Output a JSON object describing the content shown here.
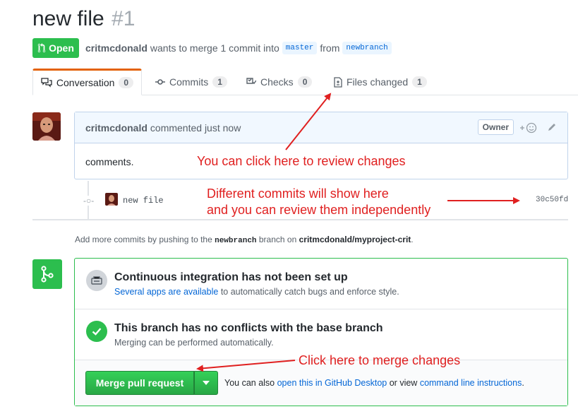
{
  "pr": {
    "title": "new file",
    "number": "#1",
    "state": "Open",
    "author": "critmcdonald",
    "action_text": "wants to merge 1 commit into",
    "base_branch": "master",
    "from_text": "from",
    "head_branch": "newbranch"
  },
  "tabs": [
    {
      "label": "Conversation",
      "count": "0",
      "icon": "comment-discussion-icon"
    },
    {
      "label": "Commits",
      "count": "1",
      "icon": "git-commit-icon"
    },
    {
      "label": "Checks",
      "count": "0",
      "icon": "checklist-icon"
    },
    {
      "label": "Files changed",
      "count": "1",
      "icon": "file-diff-icon"
    }
  ],
  "comment": {
    "author": "critmcdonald",
    "action": "commented just now",
    "badge": "Owner",
    "body": "comments."
  },
  "commit": {
    "message": "new file",
    "sha": "30c50fd"
  },
  "hint": {
    "prefix": "Add more commits by pushing to the",
    "branch": "newbranch",
    "middle": "branch on",
    "repo": "critmcdonald/myproject-crit",
    "suffix": "."
  },
  "merge_box": {
    "ci_title": "Continuous integration has not been set up",
    "ci_link": "Several apps are available",
    "ci_rest": "to automatically catch bugs and enforce style.",
    "conflict_title": "This branch has no conflicts with the base branch",
    "conflict_sub": "Merging can be performed automatically.",
    "merge_button": "Merge pull request",
    "alt_prefix": "You can also",
    "alt_link1": "open this in GitHub Desktop",
    "alt_middle": "or view",
    "alt_link2": "command line instructions",
    "alt_suffix": "."
  },
  "annotations": {
    "review": "You can click here to review changes",
    "commits_line1": "Different commits will show here",
    "commits_line2": "and you can review them independently",
    "merge": "Click here to merge changes"
  },
  "colors": {
    "open_green": "#2cbe4e",
    "annotation_red": "#e02020",
    "link_blue": "#0366d6",
    "active_tab_accent": "#e36209"
  }
}
